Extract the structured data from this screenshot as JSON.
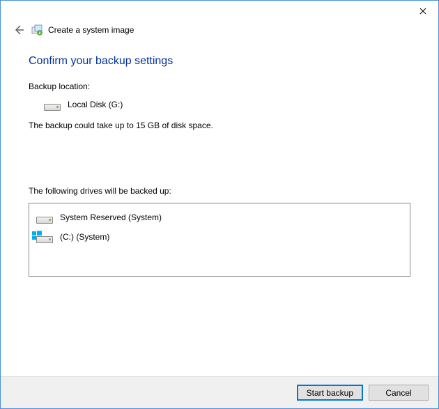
{
  "window": {
    "title": "Create a system image"
  },
  "main": {
    "heading": "Confirm your backup settings",
    "backup_location_label": "Backup location:",
    "backup_location_value": "Local Disk (G:)",
    "size_info": "The backup could take up to 15 GB of disk space.",
    "drives_label": "The following drives will be backed up:",
    "drives": [
      {
        "name": "System Reserved (System)",
        "os_badge": false
      },
      {
        "name": "(C:) (System)",
        "os_badge": true
      }
    ]
  },
  "footer": {
    "primary": "Start backup",
    "cancel": "Cancel"
  }
}
